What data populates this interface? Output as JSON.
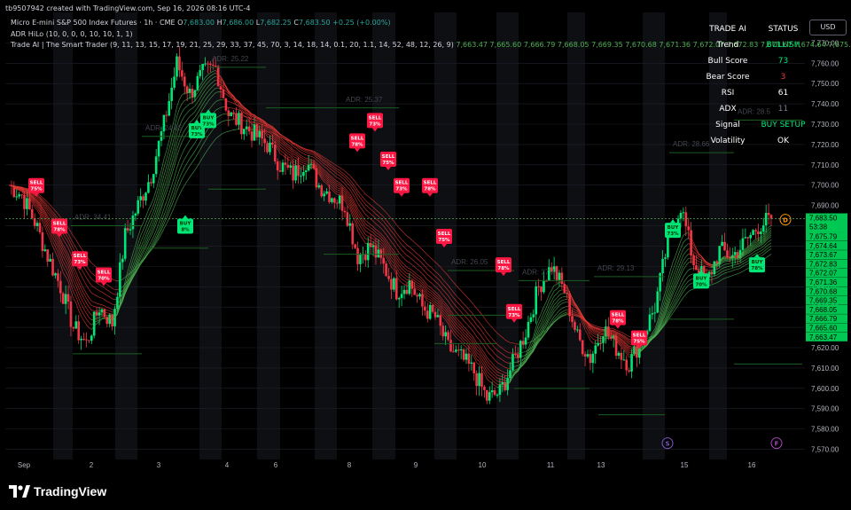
{
  "header": {
    "created_line": "tb9507942 created with TradingView.com, Sep 16, 2026 08:16 UTC-4",
    "symbol": "Micro E-mini S&P 500 Index Futures · 1h · CME",
    "ohlc": {
      "o_label": "O",
      "o": "7,683.00",
      "h_label": "H",
      "h": "7,686.00",
      "l_label": "L",
      "l": "7,682.25",
      "c_label": "C",
      "c": "7,683.50",
      "change": "+0.25 (+0.00%)"
    },
    "indicator1": "ADR HiLo (10, 0, 0, 0, 10, 10, 1, 1)",
    "indicator2": "Trade AI | The Smart Trader (9, 11, 13, 15, 17, 19, 21, 25, 29, 33, 37, 45, 70, 3, 14, 18, 14, 0.1, 20, 1.1, 14, 52, 48, 12, 26, 9)",
    "indicator2_values": "7,663.47  7,665.60  7,666.79  7,668.05  7,669.35  7,670.68  7,671.36  7,672.07  7,672.83  7,673.67  7,674.64  7,675.79"
  },
  "currency_button": "USD",
  "status_panel": {
    "header": [
      "TRADE AI",
      "STATUS"
    ],
    "rows": [
      {
        "label": "Trend",
        "value": "BULLISH",
        "color": "#00e676"
      },
      {
        "label": "Bull Score",
        "value": "73",
        "color": "#00e676"
      },
      {
        "label": "Bear Score",
        "value": "3",
        "color": "#f23645"
      },
      {
        "label": "RSI",
        "value": "61",
        "color": "#ffffff"
      },
      {
        "label": "ADX",
        "value": "11",
        "color": "#787b86"
      },
      {
        "label": "Signal",
        "value": "BUY SETUP",
        "color": "#00e676"
      },
      {
        "label": "Volatility",
        "value": "OK",
        "color": "#ffffff"
      }
    ]
  },
  "branding": "TradingView",
  "colors": {
    "bull": "#00e676",
    "bear": "#f23645",
    "ribbon_bull": "#4caf50",
    "ribbon_bear": "#e53935",
    "grid": "#1e222d",
    "session_shade": "#0e0f13"
  },
  "chart_data": {
    "type": "candlestick",
    "symbol": "MES 1h",
    "x_ticks": [
      "Sep",
      "2",
      "3",
      "4",
      "6",
      "8",
      "9",
      "10",
      "11",
      "13",
      "15",
      "16"
    ],
    "ylim": [
      7565,
      7785
    ],
    "y_ticks": [
      7570,
      7580,
      7590,
      7600,
      7610,
      7620,
      7630,
      7640,
      7650,
      7660,
      7670,
      7680,
      7690,
      7700,
      7710,
      7720,
      7730,
      7740,
      7750,
      7760,
      7770
    ],
    "last_price": "7,683.50",
    "last_price_countdown": "53:38",
    "ribbon_values": [
      "7,675.79",
      "7,674.64",
      "7,673.67",
      "7,672.83",
      "7,672.07",
      "7,671.36",
      "7,670.68",
      "7,669.35",
      "7,668.05",
      "7,666.79",
      "7,665.60",
      "7,663.47"
    ],
    "close_path": [
      7700,
      7695,
      7682,
      7665,
      7650,
      7630,
      7622,
      7640,
      7632,
      7675,
      7690,
      7705,
      7730,
      7760,
      7745,
      7755,
      7758,
      7735,
      7730,
      7725,
      7720,
      7710,
      7705,
      7712,
      7700,
      7695,
      7690,
      7665,
      7670,
      7660,
      7648,
      7652,
      7640,
      7635,
      7620,
      7615,
      7608,
      7595,
      7598,
      7612,
      7628,
      7650,
      7660,
      7648,
      7625,
      7615,
      7630,
      7620,
      7612,
      7625,
      7640,
      7672,
      7690,
      7662,
      7652,
      7668,
      7665,
      7672,
      7680,
      7683.5
    ],
    "adr_labels": [
      {
        "label": "ADR: 34.41",
        "price": 7683
      },
      {
        "label": "ADR: 24.65",
        "price": 7727
      },
      {
        "label": "ADR: 25.22",
        "price": 7761
      },
      {
        "label": "ADR: 25.37",
        "price": 7741
      },
      {
        "label": "ADR: 26.05",
        "price": 7661
      },
      {
        "label": "ADR: 27.4",
        "price": 7656
      },
      {
        "label": "ADR: 29.13",
        "price": 7658
      },
      {
        "label": "ADR: 28.66",
        "price": 7719
      },
      {
        "label": "ADR: 28.5",
        "price": 7735
      }
    ],
    "signals": [
      {
        "type": "SELL",
        "pct": "75%"
      },
      {
        "type": "SELL",
        "pct": "78%"
      },
      {
        "type": "SELL",
        "pct": "73%"
      },
      {
        "type": "SELL",
        "pct": "70%"
      },
      {
        "type": "BUY",
        "pct": "8%"
      },
      {
        "type": "BUY",
        "pct": "73%"
      },
      {
        "type": "BUY",
        "pct": "73%"
      },
      {
        "type": "SELL",
        "pct": "73%"
      },
      {
        "type": "SELL",
        "pct": "78%"
      },
      {
        "type": "SELL",
        "pct": "75%"
      },
      {
        "type": "SELL",
        "pct": "73%"
      },
      {
        "type": "SELL",
        "pct": "78%"
      },
      {
        "type": "SELL",
        "pct": "75%"
      },
      {
        "type": "SELL",
        "pct": "78%"
      },
      {
        "type": "SELL",
        "pct": "73%"
      },
      {
        "type": "SELL",
        "pct": "78%"
      },
      {
        "type": "SELL",
        "pct": "75%"
      },
      {
        "type": "BUY",
        "pct": "73%"
      },
      {
        "type": "BUY",
        "pct": "70%"
      },
      {
        "type": "BUY",
        "pct": "78%"
      }
    ],
    "event_badges": [
      "D",
      "S",
      "F"
    ]
  }
}
